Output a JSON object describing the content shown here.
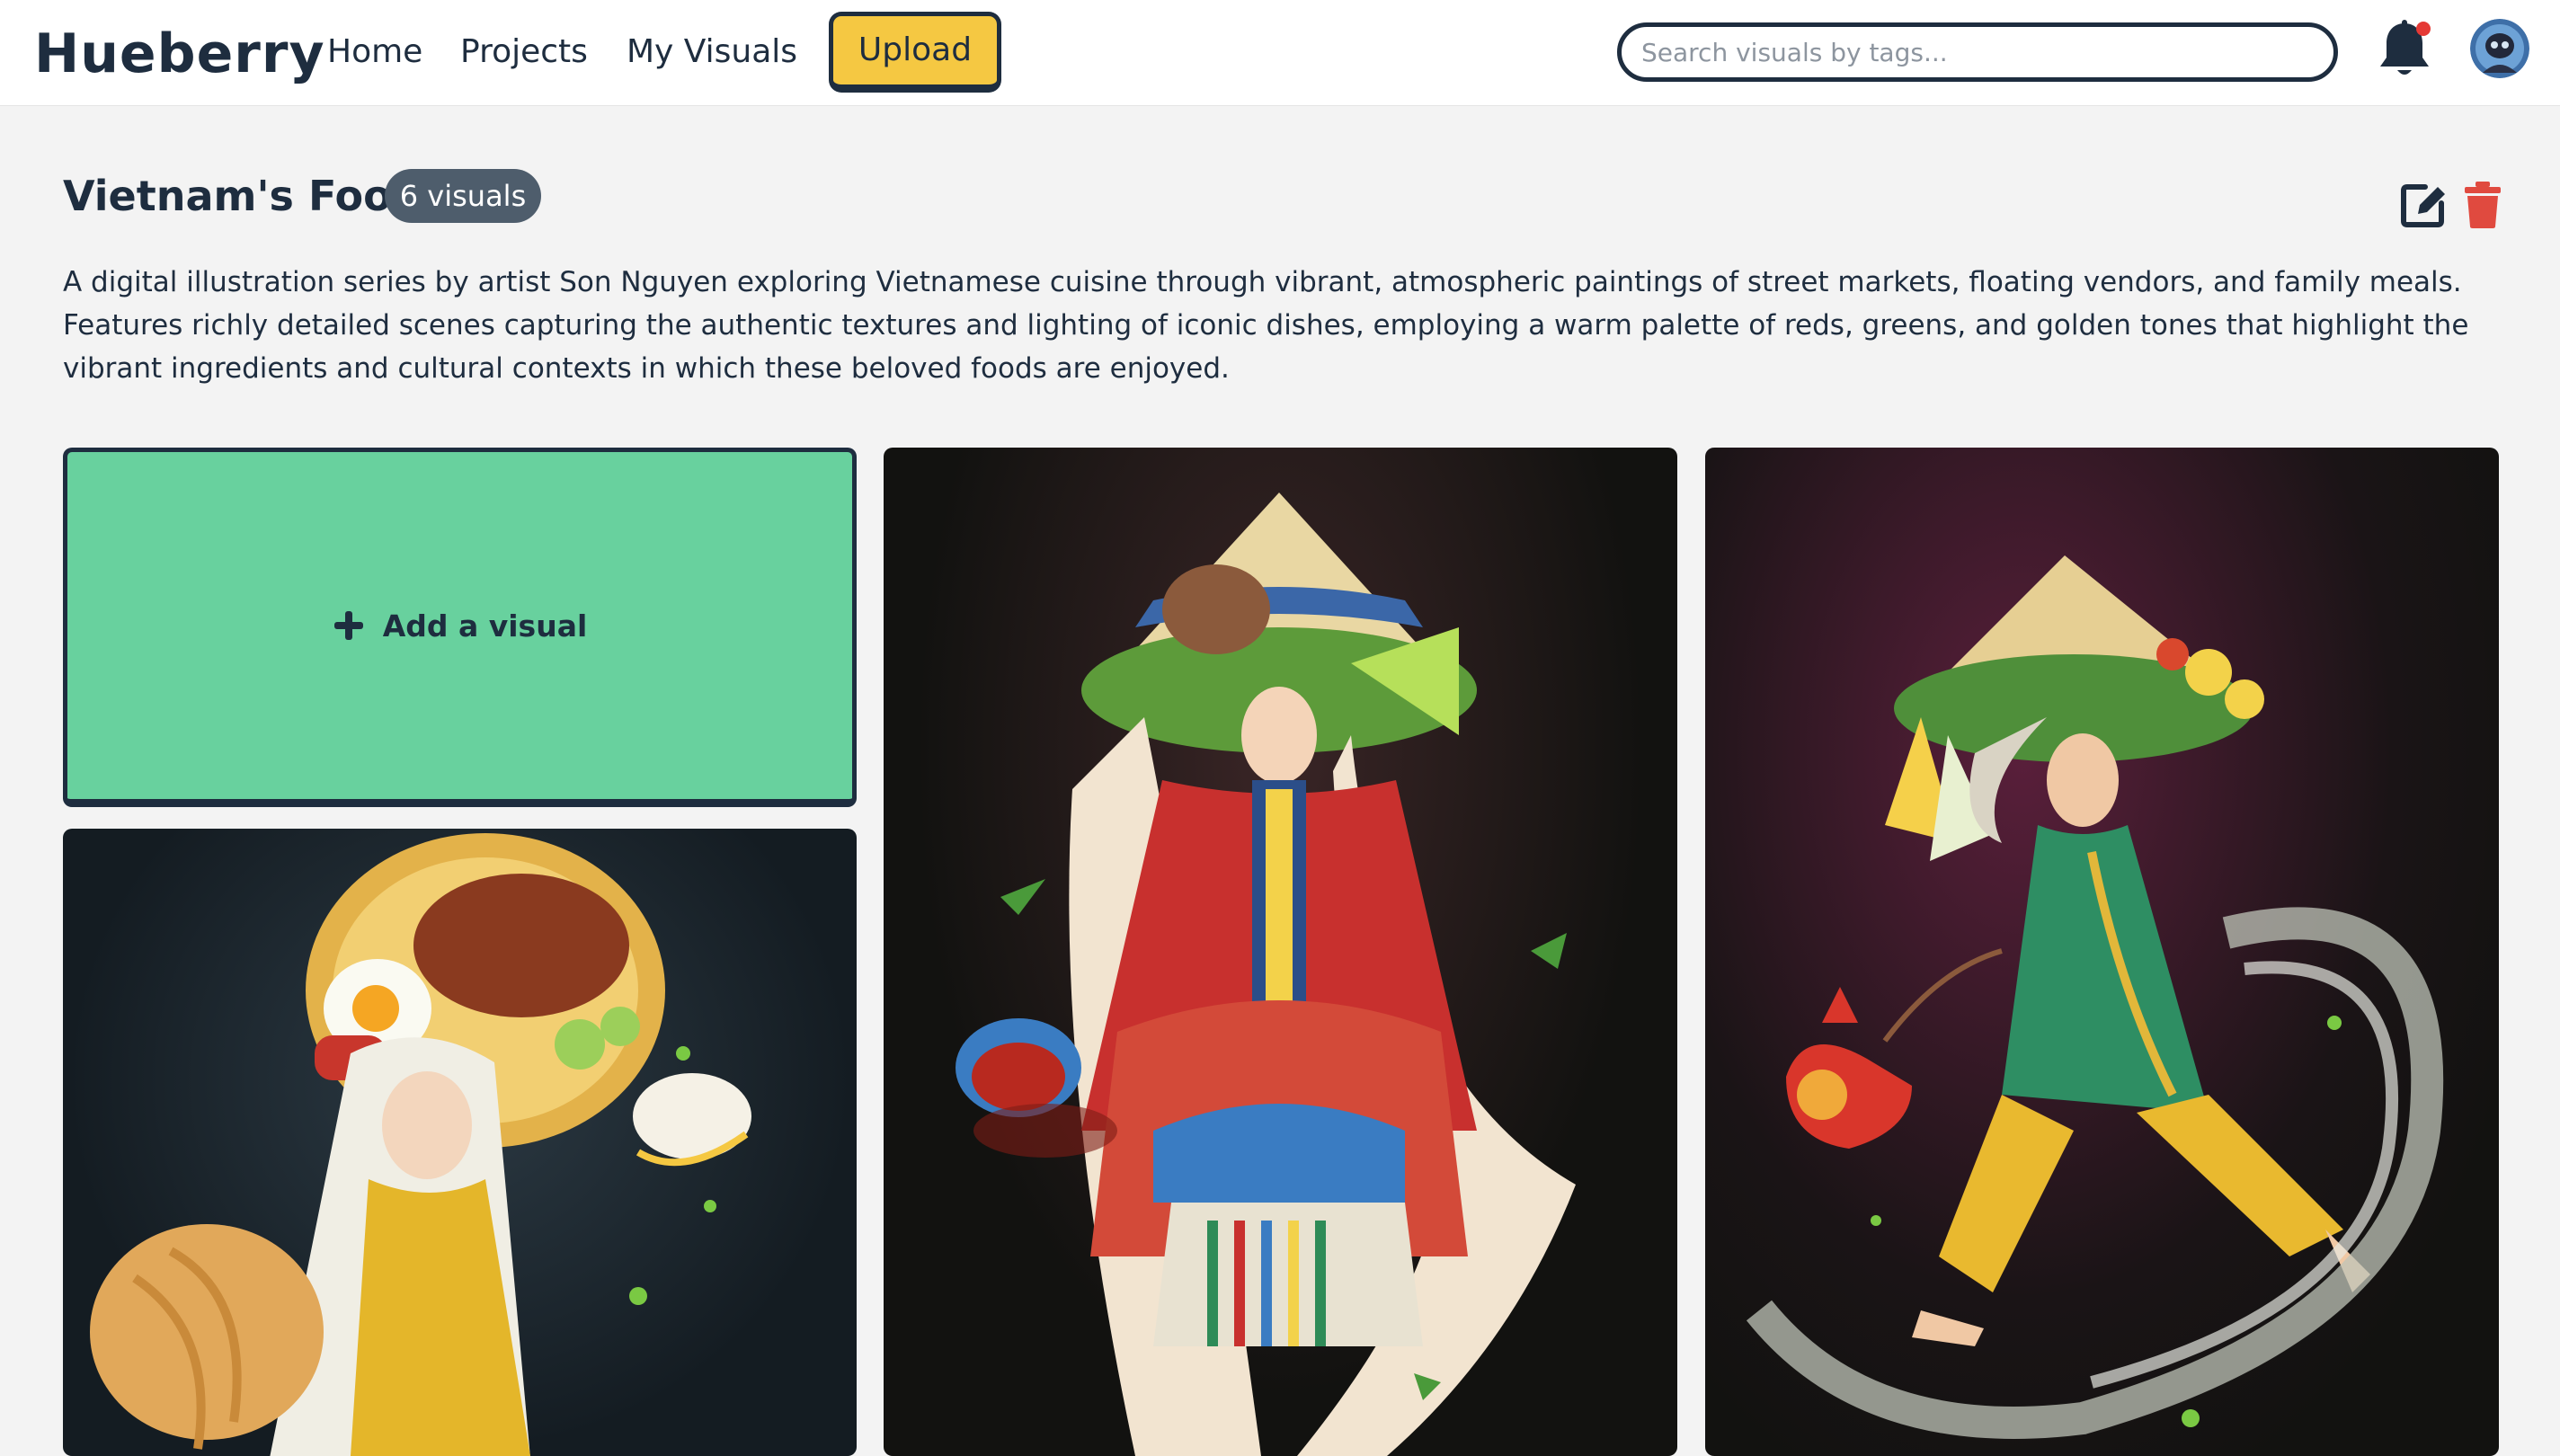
{
  "nav": {
    "brand": "Hueberry",
    "links": [
      "Home",
      "Projects",
      "My Visuals"
    ],
    "upload_label": "Upload",
    "search_placeholder": "Search visuals by tags...",
    "has_notification": true
  },
  "project": {
    "title": "Vietnam's Food",
    "count_label": "6 visuals",
    "description": "A digital illustration series by artist Son Nguyen exploring Vietnamese cuisine through vibrant, atmospheric paintings of street markets, floating vendors, and family meals. Features richly detailed scenes capturing the authentic textures and lighting of iconic dishes, employing a warm palette of reds, greens, and golden tones that highlight the vibrant ingredients and cultural contexts in which these beloved foods are enjoyed."
  },
  "grid": {
    "add_label": "Add a visual",
    "visuals": [
      {
        "subject": "woman in yellow ao dai with rice dish hat, egg and noodles"
      },
      {
        "subject": "woman in red robe with noodle soup hat and long noodle hair"
      },
      {
        "subject": "woman in green and yellow outfit with noodle hat and glass noodles"
      }
    ]
  },
  "colors": {
    "navy": "#1e2d3f",
    "upload_yellow": "#f5c842",
    "add_green": "#68d19e",
    "badge_gray": "#4e5d6c",
    "delete_red": "#e04a3f",
    "background": "#f3f3f3"
  },
  "icons": [
    "bell-icon",
    "avatar",
    "edit-icon",
    "trash-icon",
    "plus-icon"
  ]
}
